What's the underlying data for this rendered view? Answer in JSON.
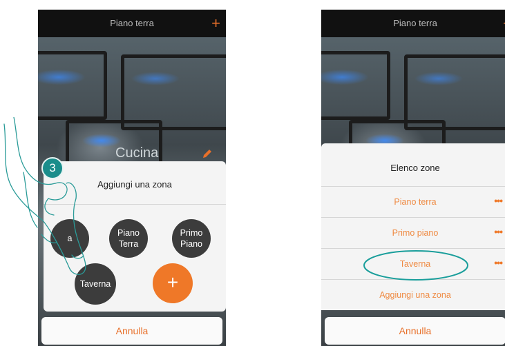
{
  "left_screen": {
    "header_title": "Piano terra",
    "plus_symbol": "+",
    "room_name": "Cucina",
    "dialog_title": "Aggiungi una zona",
    "zones": [
      {
        "label_line1": "Piano",
        "label_line2": "Terra"
      },
      {
        "label_line1": "Primo",
        "label_line2": "Piano"
      },
      {
        "label_line1": "Taverna",
        "label_line2": ""
      }
    ],
    "partial_zone_label": "a",
    "add_symbol": "+",
    "cancel_label": "Annulla"
  },
  "right_screen": {
    "header_title": "Piano terra",
    "plus_symbol": "+",
    "list_title": "Elenco zone",
    "zones": [
      {
        "label": "Piano terra",
        "menu": "•••"
      },
      {
        "label": "Primo piano",
        "menu": "•••"
      },
      {
        "label": "Taverna",
        "menu": "•••"
      }
    ],
    "add_zone_label": "Aggiungi una zona",
    "cancel_label": "Annulla"
  },
  "step_number": "3",
  "colors": {
    "accent": "#ef7828",
    "teal_highlight": "#1a9e9b",
    "dark_circle": "#3c3c3c"
  },
  "icons": [
    "plus-icon",
    "pencil-icon",
    "more-dots-icon",
    "pointing-hand-icon"
  ]
}
